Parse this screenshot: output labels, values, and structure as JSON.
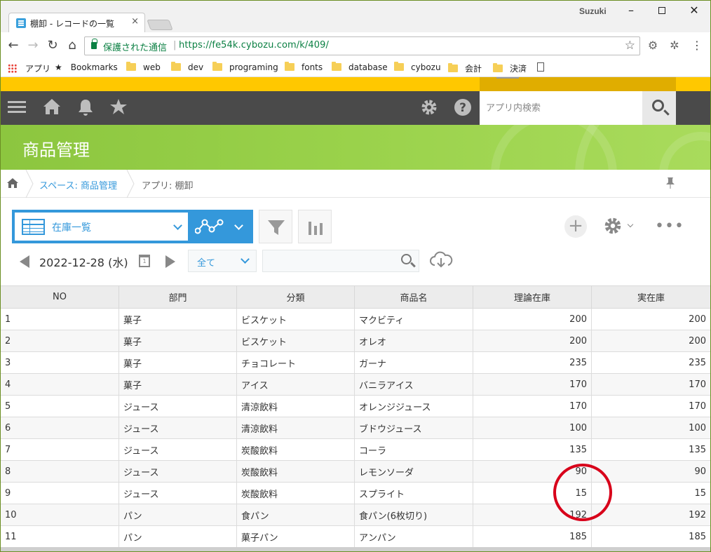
{
  "browser": {
    "tab_title": "棚卸 - レコードの一覧",
    "tab_close": "×",
    "profile": "Suzuki",
    "security_label": "保護された通信",
    "url": "https://fe54k.cybozu.com/k/409/",
    "bookmarks": {
      "apps": "アプリ",
      "bookmarks": "Bookmarks",
      "folders": [
        "web",
        "dev",
        "programing",
        "fonts",
        "database",
        "cybozu",
        "会計",
        "決済"
      ]
    }
  },
  "header": {
    "search_placeholder": "アプリ内検索"
  },
  "app": {
    "title": "商品管理"
  },
  "breadcrumb": {
    "space_prefix": "スペース: ",
    "space_name": "商品管理",
    "app_label": "アプリ: 棚卸"
  },
  "view": {
    "name": "在庫一覧",
    "date": "2022-12-28 (水)",
    "period": "全て",
    "calendar_day": "1"
  },
  "colors": {
    "accent": "#3498db",
    "banner": "#8cc63f",
    "topbar": "#4a4a4a",
    "highlight": "#d8001a"
  },
  "table": {
    "columns": [
      "NO",
      "部門",
      "分類",
      "商品名",
      "理論在庫",
      "実在庫"
    ],
    "rows": [
      [
        "1",
        "菓子",
        "ビスケット",
        "マクビティ",
        "200",
        "200"
      ],
      [
        "2",
        "菓子",
        "ビスケット",
        "オレオ",
        "200",
        "200"
      ],
      [
        "3",
        "菓子",
        "チョコレート",
        "ガーナ",
        "235",
        "235"
      ],
      [
        "4",
        "菓子",
        "アイス",
        "バニラアイス",
        "170",
        "170"
      ],
      [
        "5",
        "ジュース",
        "清涼飲料",
        "オレンジジュース",
        "170",
        "170"
      ],
      [
        "6",
        "ジュース",
        "清涼飲料",
        "ブドウジュース",
        "100",
        "100"
      ],
      [
        "7",
        "ジュース",
        "炭酸飲料",
        "コーラ",
        "135",
        "135"
      ],
      [
        "8",
        "ジュース",
        "炭酸飲料",
        "レモンソーダ",
        "90",
        "90"
      ],
      [
        "9",
        "ジュース",
        "炭酸飲料",
        "スプライト",
        "15",
        "15"
      ],
      [
        "10",
        "パン",
        "食パン",
        "食パン(6枚切り)",
        "192",
        "192"
      ],
      [
        "11",
        "パン",
        "菓子パン",
        "アンパン",
        "185",
        "185"
      ]
    ]
  }
}
